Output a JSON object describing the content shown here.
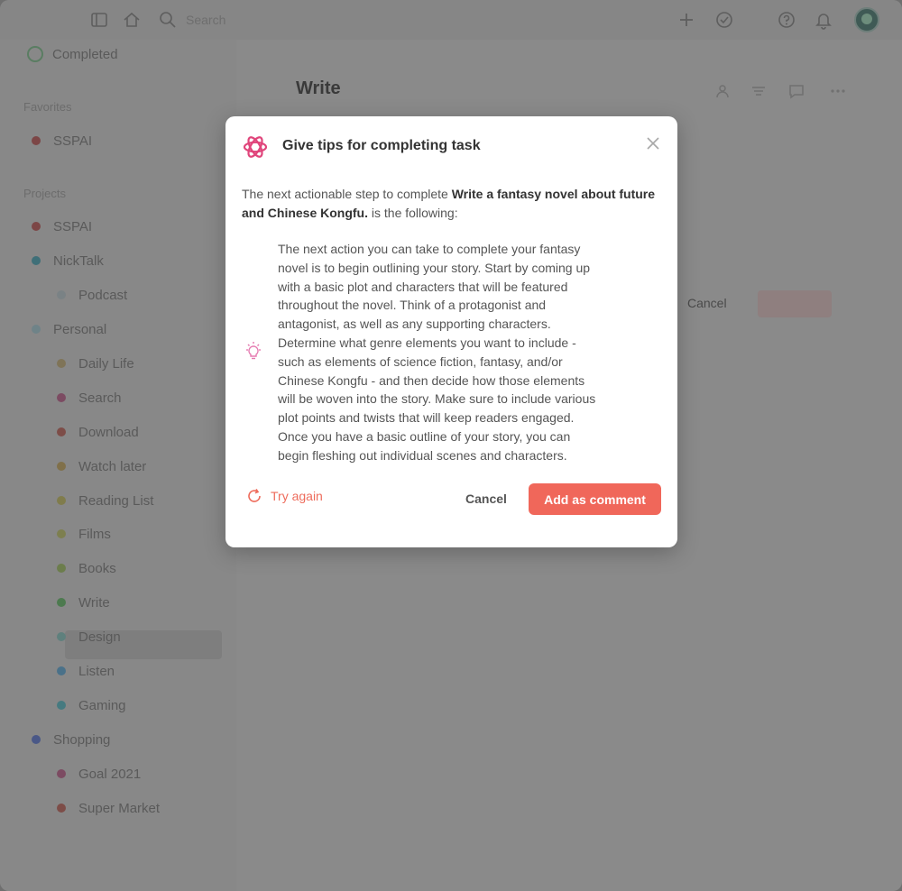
{
  "colors": {
    "accent": "#f0675a",
    "overlay_bg": "#8a8a8a",
    "dialog_bg": "#ffffff"
  },
  "topbar": {
    "search_placeholder": "Search",
    "icons": [
      "menu-icon",
      "home-icon",
      "search-icon",
      "plus-icon",
      "check-score-icon",
      "help-icon",
      "bell-icon",
      "avatar"
    ]
  },
  "sidebar": {
    "completed_label": "Completed",
    "favorites_heading": "Favorites",
    "favorites": [
      {
        "label": "SSPAI",
        "color": "#7c4646"
      }
    ],
    "projects_heading": "Projects",
    "projects": [
      {
        "label": "SSPAI",
        "color": "#7c4646"
      },
      {
        "label": "NickTalk",
        "color": "#3f6f78"
      },
      {
        "label": "Podcast",
        "color": "#7a8285"
      },
      {
        "label": "Personal",
        "color": "#6f8388"
      },
      {
        "label": "Daily Life",
        "color": "#7f7458"
      },
      {
        "label": "Search",
        "color": "#7c4b62"
      },
      {
        "label": "Download",
        "color": "#7d4d48"
      },
      {
        "label": "Watch later",
        "color": "#80704a"
      },
      {
        "label": "Reading List",
        "color": "#807c4c"
      },
      {
        "label": "Films",
        "color": "#7d7f4f"
      },
      {
        "label": "Books",
        "color": "#6c7d4c"
      },
      {
        "label": "Write",
        "color": "#4d7a4f"
      },
      {
        "label": "Design",
        "color": "#5f807d"
      },
      {
        "label": "Listen",
        "color": "#4a7189"
      },
      {
        "label": "Gaming",
        "color": "#467a80"
      },
      {
        "label": "Shopping",
        "color": "#4a5887"
      },
      {
        "label": "Goal 2021",
        "color": "#7c4b62"
      },
      {
        "label": "Super Market",
        "color": "#7d4d48"
      }
    ]
  },
  "main": {
    "title": "Write",
    "cancel_label": "Cancel"
  },
  "dialog": {
    "title": "Give tips for completing task",
    "intro_prefix": "The next actionable step to complete ",
    "task_name": "Write a fantasy novel about future and Chinese Kongfu.",
    "intro_suffix": " is the following:",
    "tip_lines": [
      "The next action you can take to complete your fantasy",
      "novel is to begin outlining your story. Start by coming up",
      "with a basic plot and characters that will be featured",
      "throughout the novel. Think of a protagonist and",
      "antagonist, as well as any supporting characters.",
      "Determine what genre elements you want to include -",
      "such as elements of science fiction, fantasy, and/or",
      "Chinese Kongfu - and then decide how those elements",
      "will be woven into the story. Make sure to include various",
      "plot points and twists that will keep readers engaged.",
      "Once you have a basic outline of your story, you can",
      "begin fleshing out individual scenes and characters."
    ],
    "try_again_label": "Try again",
    "cancel_label": "Cancel",
    "add_comment_label": "Add as comment"
  }
}
